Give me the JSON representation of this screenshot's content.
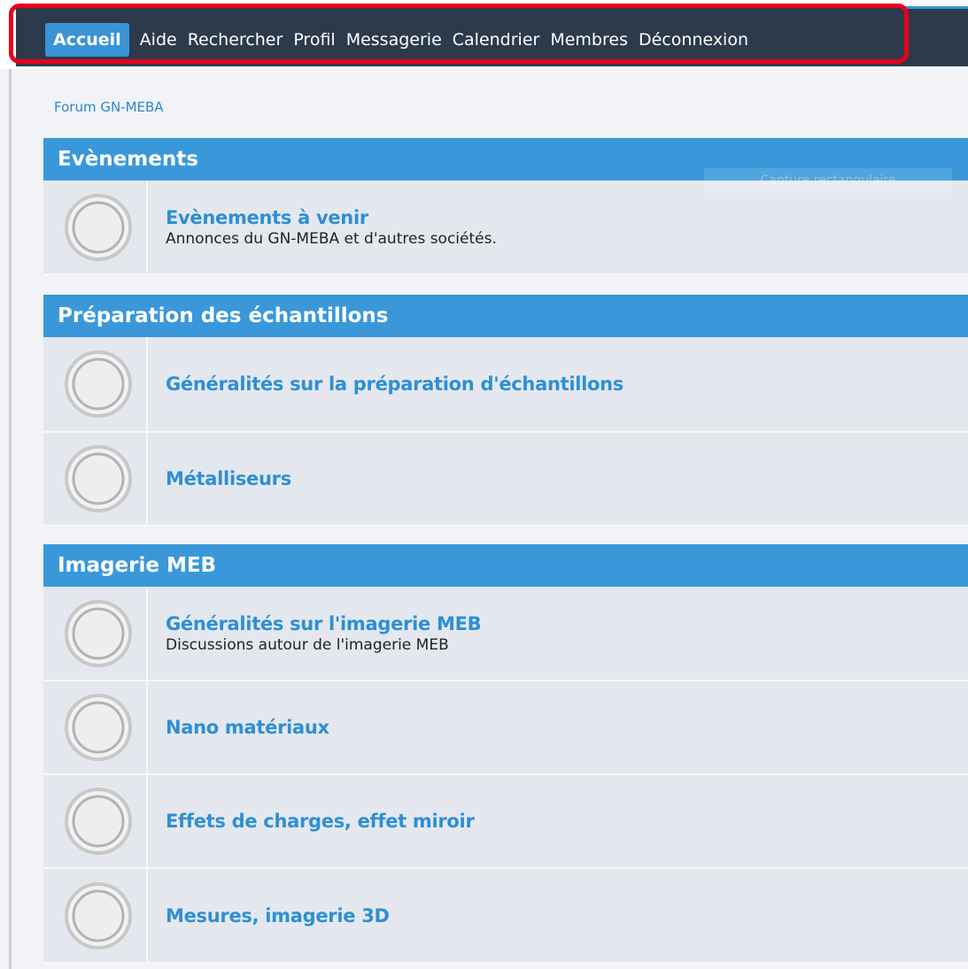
{
  "nav": {
    "items": [
      {
        "label": "Accueil",
        "active": true
      },
      {
        "label": "Aide"
      },
      {
        "label": "Rechercher"
      },
      {
        "label": "Profil"
      },
      {
        "label": "Messagerie"
      },
      {
        "label": "Calendrier"
      },
      {
        "label": "Membres"
      },
      {
        "label": "Déconnexion"
      }
    ]
  },
  "breadcrumb": "Forum GN-MEBA",
  "overlay_text": "Capture rectangulaire",
  "categories": [
    {
      "title": "Evènements",
      "forums": [
        {
          "title": "Evènements à venir",
          "description": "Annonces du GN-MEBA et d'autres sociétés."
        }
      ]
    },
    {
      "title": "Préparation des échantillons",
      "forums": [
        {
          "title": "Généralités sur la préparation d'échantillons"
        },
        {
          "title": "Métalliseurs"
        }
      ]
    },
    {
      "title": "Imagerie MEB",
      "forums": [
        {
          "title": "Généralités sur l'imagerie MEB",
          "description": "Discussions autour de l'imagerie MEB"
        },
        {
          "title": "Nano matériaux"
        },
        {
          "title": "Effets de charges, effet miroir"
        },
        {
          "title": "Mesures, imagerie 3D"
        }
      ]
    }
  ],
  "colors": {
    "navbar": "#2c3a4c",
    "accent": "#3a98da",
    "highlight": "#e8001c",
    "link": "#2e8fd4"
  }
}
